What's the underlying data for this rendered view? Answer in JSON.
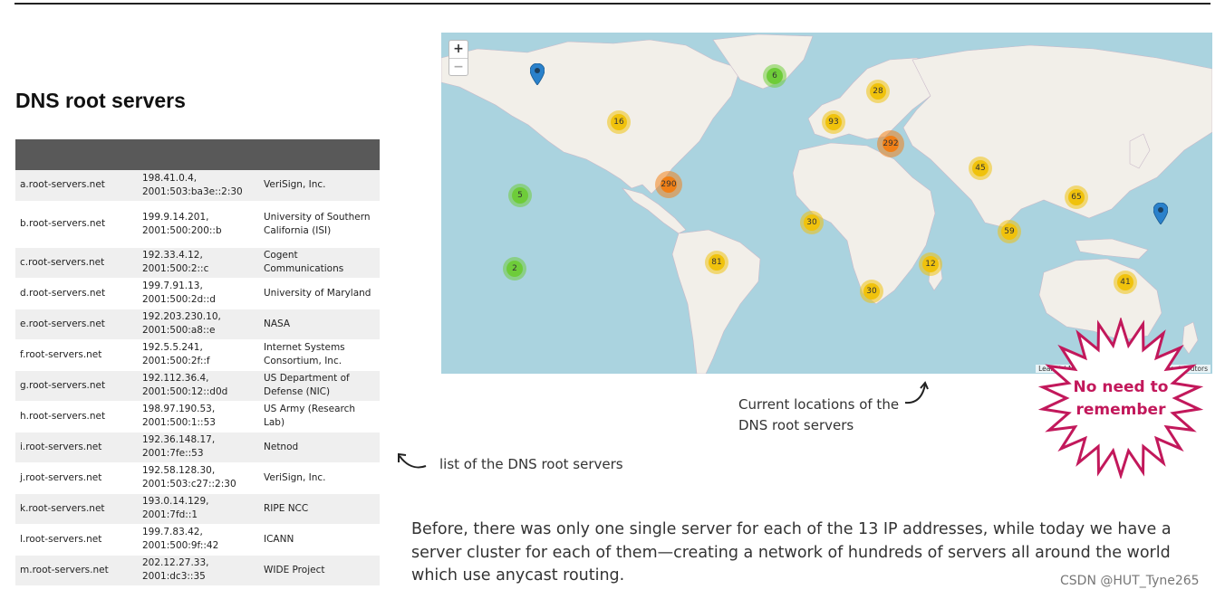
{
  "slide": {
    "title": "DNS root servers"
  },
  "root_servers": [
    {
      "host": "a.root-servers.net",
      "ip4": "198.41.0.4,",
      "ip6": "2001:503:ba3e::2:30",
      "operator": "VeriSign, Inc.",
      "operator2": ""
    },
    {
      "host": "b.root-servers.net",
      "ip4": "199.9.14.201,",
      "ip6": "2001:500:200::b",
      "operator": "University of Southern",
      "operator2": "California (ISI)"
    },
    {
      "host": "c.root-servers.net",
      "ip4": "192.33.4.12,",
      "ip6": "2001:500:2::c",
      "operator": "Cogent Communications",
      "operator2": ""
    },
    {
      "host": "d.root-servers.net",
      "ip4": "199.7.91.13,",
      "ip6": "2001:500:2d::d",
      "operator": "University of Maryland",
      "operator2": ""
    },
    {
      "host": "e.root-servers.net",
      "ip4": "192.203.230.10,",
      "ip6": "2001:500:a8::e",
      "operator": "NASA",
      "operator2": ""
    },
    {
      "host": "f.root-servers.net",
      "ip4": "192.5.5.241,",
      "ip6": "2001:500:2f::f",
      "operator": "Internet Systems",
      "operator2": "Consortium, Inc."
    },
    {
      "host": "g.root-servers.net",
      "ip4": "192.112.36.4,",
      "ip6": "2001:500:12::d0d",
      "operator": "US Department of",
      "operator2": "Defense (NIC)"
    },
    {
      "host": "h.root-servers.net",
      "ip4": "198.97.190.53,",
      "ip6": "2001:500:1::53",
      "operator": "US Army (Research Lab)",
      "operator2": ""
    },
    {
      "host": "i.root-servers.net",
      "ip4": "192.36.148.17,",
      "ip6": "2001:7fe::53",
      "operator": "Netnod",
      "operator2": ""
    },
    {
      "host": "j.root-servers.net",
      "ip4": "192.58.128.30,",
      "ip6": "2001:503:c27::2:30",
      "operator": "VeriSign, Inc.",
      "operator2": ""
    },
    {
      "host": "k.root-servers.net",
      "ip4": "193.0.14.129, 2001:7fd::1",
      "ip6": "",
      "operator": "RIPE NCC",
      "operator2": ""
    },
    {
      "host": "l.root-servers.net",
      "ip4": "199.7.83.42,",
      "ip6": "2001:500:9f::42",
      "operator": "ICANN",
      "operator2": ""
    },
    {
      "host": "m.root-servers.net",
      "ip4": "202.12.27.33,",
      "ip6": "2001:dc3::35",
      "operator": "WIDE Project",
      "operator2": ""
    }
  ],
  "map": {
    "zoom_in": "+",
    "zoom_out": "−",
    "attribution": "Leaflet | Map data © OpenStreetMap contributors",
    "clusters": [
      {
        "count": "6",
        "level": "green"
      },
      {
        "count": "28",
        "level": "yellow"
      },
      {
        "count": "16",
        "level": "yellow"
      },
      {
        "count": "93",
        "level": "yellow"
      },
      {
        "count": "292",
        "level": "orange"
      },
      {
        "count": "45",
        "level": "yellow"
      },
      {
        "count": "290",
        "level": "orange"
      },
      {
        "count": "5",
        "level": "green"
      },
      {
        "count": "65",
        "level": "yellow"
      },
      {
        "count": "30",
        "level": "yellow"
      },
      {
        "count": "59",
        "level": "yellow"
      },
      {
        "count": "2",
        "level": "green"
      },
      {
        "count": "81",
        "level": "yellow"
      },
      {
        "count": "12",
        "level": "yellow"
      },
      {
        "count": "30",
        "level": "yellow"
      },
      {
        "count": "41",
        "level": "yellow"
      }
    ]
  },
  "captions": {
    "map_line1": "Current locations of the",
    "map_line2": "DNS root servers",
    "list": "list of the DNS root servers"
  },
  "paragraph": "Before, there was only one single server for each of the 13 IP addresses, while today we have a server cluster for each of them—creating a network of hundreds of servers all around the world which use anycast routing.",
  "callout": {
    "line1": "No need to",
    "line2": "remember"
  },
  "watermark": "CSDN @HUT_Tyne265",
  "colors": {
    "map_water": "#aad3df",
    "map_land": "#f2efe9",
    "cluster_green": "#6ecc39",
    "cluster_yellow": "#f0c20c",
    "cluster_orange": "#f18017",
    "callout": "#c2185b"
  }
}
